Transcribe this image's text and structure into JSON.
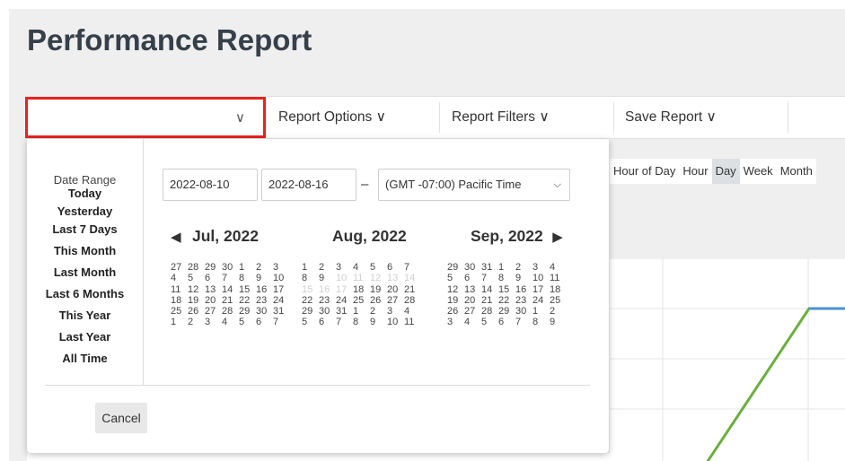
{
  "page": {
    "title": "Performance Report"
  },
  "toolbar": {
    "date_range_value": "",
    "report_options": "Report Options",
    "report_filters": "Report Filters",
    "save_report": "Save Report",
    "chevron": "∨"
  },
  "granularity": {
    "options": [
      "Hour of Day",
      "Hour",
      "Day",
      "Week",
      "Month"
    ],
    "selected": "Day"
  },
  "date_picker": {
    "ranges_title": "Date Range",
    "ranges": [
      "Today",
      "Yesterday",
      "Last 7 Days",
      "This Month",
      "Last Month",
      "Last 6 Months",
      "This Year",
      "Last Year",
      "All Time"
    ],
    "start_date": "2022-08-10",
    "end_date": "2022-08-16",
    "separator": "–",
    "timezone": "(GMT -07:00) Pacific Time",
    "prev_icon": "◀",
    "next_icon": "▶",
    "months": [
      {
        "label": "Jul, 2022",
        "days": [
          "27",
          "28",
          "29",
          "30",
          "1",
          "2",
          "3",
          "4",
          "5",
          "6",
          "7",
          "8",
          "9",
          "10",
          "11",
          "12",
          "13",
          "14",
          "15",
          "16",
          "17",
          "18",
          "19",
          "20",
          "21",
          "22",
          "23",
          "24",
          "25",
          "26",
          "27",
          "28",
          "29",
          "30",
          "31",
          "1",
          "2",
          "3",
          "4",
          "5",
          "6",
          "7"
        ],
        "disabled": []
      },
      {
        "label": "Aug, 2022",
        "days": [
          "1",
          "2",
          "3",
          "4",
          "5",
          "6",
          "7",
          "8",
          "9",
          "10",
          "11",
          "12",
          "13",
          "14",
          "15",
          "16",
          "17",
          "18",
          "19",
          "20",
          "21",
          "22",
          "23",
          "24",
          "25",
          "26",
          "27",
          "28",
          "29",
          "30",
          "31",
          "1",
          "2",
          "3",
          "4",
          "5",
          "6",
          "7",
          "8",
          "9",
          "10",
          "11"
        ],
        "disabled": [
          9,
          10,
          11,
          12,
          13,
          14,
          15,
          16
        ]
      },
      {
        "label": "Sep, 2022",
        "days": [
          "29",
          "30",
          "31",
          "1",
          "2",
          "3",
          "4",
          "5",
          "6",
          "7",
          "8",
          "9",
          "10",
          "11",
          "12",
          "13",
          "14",
          "15",
          "16",
          "17",
          "18",
          "19",
          "20",
          "21",
          "22",
          "23",
          "24",
          "25",
          "26",
          "27",
          "28",
          "29",
          "30",
          "1",
          "2",
          "3",
          "4",
          "5",
          "6",
          "7",
          "8",
          "9"
        ],
        "disabled": []
      }
    ],
    "cancel_label": "Cancel"
  },
  "colors": {
    "highlight_border": "#e52420",
    "series_green": "#6aaf3d",
    "series_blue": "#4a90d9"
  }
}
